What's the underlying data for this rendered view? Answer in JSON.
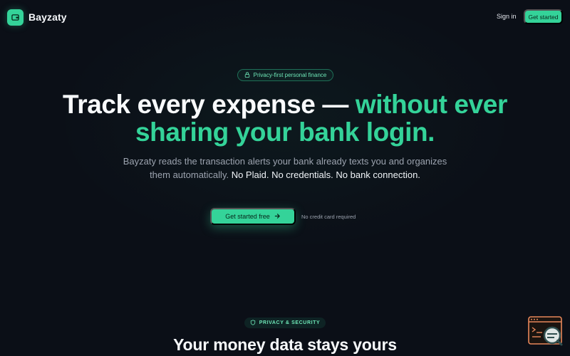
{
  "header": {
    "brand_name": "Bayzaty",
    "signin_label": "Sign in",
    "cta_label": "Get started"
  },
  "hero": {
    "pill_text": "Privacy-first personal finance",
    "title_part1": "Track every expense — ",
    "title_accent": "without ever sharing your bank login.",
    "subtitle_part1": "Bayzaty reads the transaction alerts your bank already texts you and organizes them automatically. ",
    "subtitle_strong": "No Plaid. No credentials. No bank connection.",
    "cta_label": "Get started free",
    "cta_note": "No credit card required"
  },
  "privacy_section": {
    "pill_text": "PRIVACY & SECURITY",
    "title": "Your money data stays yours"
  },
  "icons": {
    "brand": "wallet-icon",
    "pill": "lock-icon",
    "cta": "arrow-right-icon",
    "section": "shield-icon",
    "widget": "terminal-search-icon"
  },
  "colors": {
    "background": "#0b0f17",
    "accent": "#34d399",
    "accent_light": "#6ee7b7",
    "muted_text": "#9ca3af",
    "widget_accent": "#e8875a"
  }
}
